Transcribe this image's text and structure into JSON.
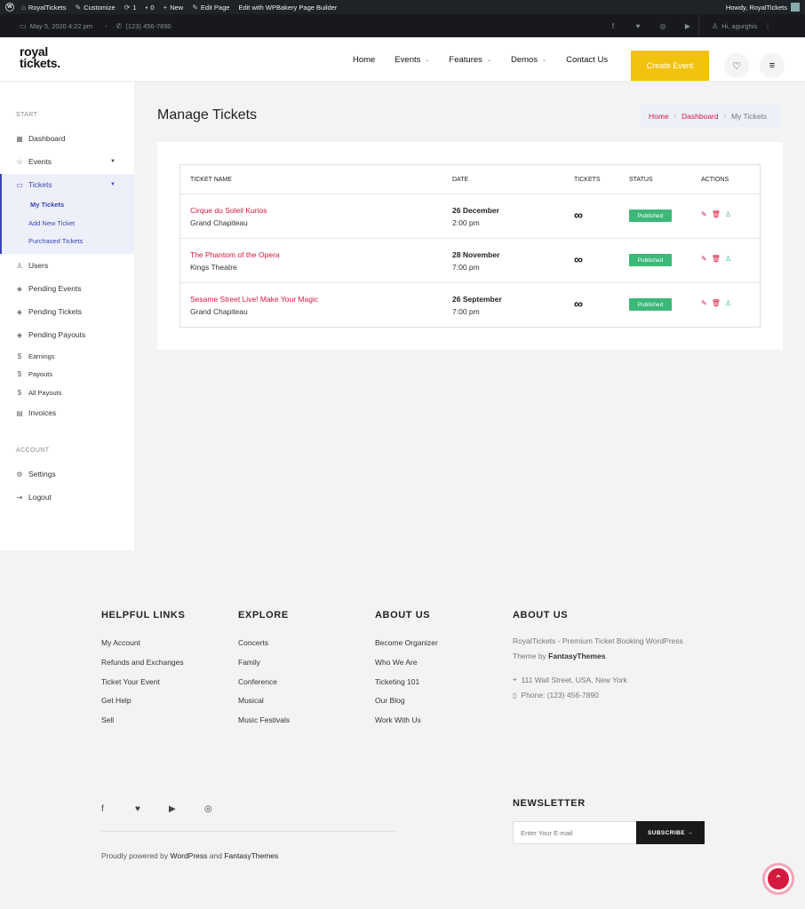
{
  "adminbar": {
    "site": "RoyalTickets",
    "customize": "Customize",
    "updates": "1",
    "comments": "0",
    "new": "New",
    "edit_page": "Edit Page",
    "wpbakery": "Edit with WPBakery Page Builder",
    "howdy": "Howdy, RoyalTickets"
  },
  "topbar": {
    "datetime": "May 5, 2020 4:22 pm",
    "phone": "(123) 456-7890",
    "user": "Hi, agurghis"
  },
  "header": {
    "logo_line1": "royal",
    "logo_line2": "tickets.",
    "nav": [
      "Home",
      "Events",
      "Features",
      "Demos",
      "Contact Us"
    ],
    "create_label": "Create Event"
  },
  "sidebar": {
    "start_label": "START",
    "account_label": "ACCOUNT",
    "dashboard": "Dashboard",
    "events": "Events",
    "tickets": "Tickets",
    "sub": [
      "My Tickets",
      "Add New Ticket",
      "Purchased Tickets"
    ],
    "items": [
      "Users",
      "Pending Events",
      "Pending Tickets",
      "Pending Payouts",
      "Earnings",
      "Payouts",
      "All Payouts",
      "Invoices"
    ],
    "settings": "Settings",
    "logout": "Logout"
  },
  "main": {
    "title": "Manage Tickets",
    "breadcrumb": [
      "Home",
      "Dashboard",
      "My Tickets"
    ],
    "columns": [
      "TICKET NAME",
      "DATE",
      "TICKETS",
      "STATUS",
      "ACTIONS"
    ],
    "rows": [
      {
        "name": "Cirque du Soleil Kurios",
        "venue": "Grand Chapiteau",
        "date": "26 December",
        "time": "2:00 pm",
        "tickets": "∞",
        "status": "Published"
      },
      {
        "name": "The Phantom of the Opera",
        "venue": "Kings Theatre",
        "date": "28 November",
        "time": "7:00 pm",
        "tickets": "∞",
        "status": "Published"
      },
      {
        "name": "Sesame Street Live! Make Your Magic",
        "venue": "Grand Chapiteau",
        "date": "26 September",
        "time": "7:00 pm",
        "tickets": "∞",
        "status": "Published"
      }
    ]
  },
  "footer": {
    "col1_title": "HELPFUL LINKS",
    "col1": [
      "My Account",
      "Refunds and Exchanges",
      "Ticket Your Event",
      "Get Help",
      "Sell"
    ],
    "col2_title": "EXPLORE",
    "col2": [
      "Concerts",
      "Family",
      "Conference",
      "Musical",
      "Music Festivals"
    ],
    "col3_title": "ABOUT US",
    "col3": [
      "Become Organizer",
      "Who We Are",
      "Ticketing 101",
      "Our Blog",
      "Work With Us"
    ],
    "col4_title": "ABOUT US",
    "about_text": "RoyalTickets - Premium Ticket Booking WordPress Theme by",
    "about_brand": "FantasyThemes",
    "about_end": ".",
    "address": "111 Wall Street, USA, New York",
    "phone": "Phone: (123) 456-7890",
    "newsletter_title": "NEWSLETTER",
    "email_placeholder": "Enter Your E-mail",
    "subscribe_label": "SUBSCRIBE →",
    "copy_pre": "Proudly powered by",
    "copy_wp": "WordPress",
    "copy_and": "and",
    "copy_ft": "FantasyThemes"
  },
  "colors": {
    "accent": "#d6193f",
    "brand_yellow": "#f3c20f",
    "published": "#3cb878",
    "sidebar_active": "#3b46b4"
  }
}
